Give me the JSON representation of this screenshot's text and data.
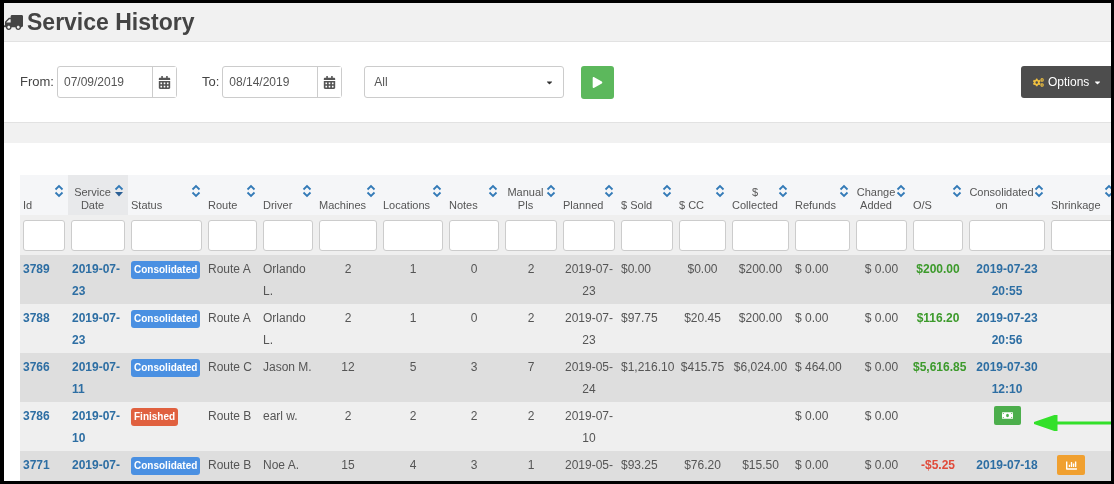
{
  "page": {
    "title": "Service History"
  },
  "filters": {
    "from_label": "From:",
    "from_value": "07/09/2019",
    "to_label": "To:",
    "to_value": "08/14/2019",
    "select_value": "All",
    "options_label": "Options"
  },
  "columns": [
    {
      "label": "Id",
      "sorted": false
    },
    {
      "label": "Service Date",
      "sorted": true
    },
    {
      "label": "Status",
      "sorted": false
    },
    {
      "label": "Route",
      "sorted": false
    },
    {
      "label": "Driver",
      "sorted": false
    },
    {
      "label": "Machines",
      "sorted": false
    },
    {
      "label": "Locations",
      "sorted": false
    },
    {
      "label": "Notes",
      "sorted": false
    },
    {
      "label": "Manual Pls",
      "sorted": false
    },
    {
      "label": "Planned",
      "sorted": false
    },
    {
      "label": "$ Sold",
      "sorted": false
    },
    {
      "label": "$ CC",
      "sorted": false
    },
    {
      "label": "$ Collected",
      "sorted": false
    },
    {
      "label": "Refunds",
      "sorted": false
    },
    {
      "label": "Change Added",
      "sorted": false
    },
    {
      "label": "O/S",
      "sorted": false
    },
    {
      "label": "Consolidated on",
      "sorted": false
    },
    {
      "label": "Shrinkage",
      "sorted": false
    }
  ],
  "rows": [
    {
      "id": "3789",
      "date": "2019-07-23",
      "status": {
        "label": "Consolidated",
        "kind": "consolidated"
      },
      "route": "Route A",
      "driver": "Orlando L.",
      "machines": "2",
      "locations": "1",
      "notes": "0",
      "manual": "2",
      "planned": "2019-07-23",
      "sold": "$0.00",
      "cc": "$0.00",
      "collected": "$200.00",
      "refunds": "$ 0.00",
      "change": "$ 0.00",
      "os": {
        "text": "$200.00",
        "kind": "positive"
      },
      "consolidated": {
        "kind": "text",
        "text": "2019-07-23 20:55"
      }
    },
    {
      "id": "3788",
      "date": "2019-07-23",
      "status": {
        "label": "Consolidated",
        "kind": "consolidated"
      },
      "route": "Route A",
      "driver": "Orlando L.",
      "machines": "2",
      "locations": "1",
      "notes": "0",
      "manual": "2",
      "planned": "2019-07-23",
      "sold": "$97.75",
      "cc": "$20.45",
      "collected": "$200.00",
      "refunds": "$ 0.00",
      "change": "$ 0.00",
      "os": {
        "text": "$116.20",
        "kind": "positive"
      },
      "consolidated": {
        "kind": "text",
        "text": "2019-07-23 20:56"
      }
    },
    {
      "id": "3766",
      "date": "2019-07-11",
      "status": {
        "label": "Consolidated",
        "kind": "consolidated"
      },
      "route": "Route C",
      "driver": "Jason M.",
      "machines": "12",
      "locations": "5",
      "notes": "3",
      "manual": "7",
      "planned": "2019-05-24",
      "sold": "$1,216.10",
      "cc": "$415.75",
      "collected": "$6,024.00",
      "refunds": "$ 464.00",
      "change": "$ 0.00",
      "os": {
        "text": "$5,616.85",
        "kind": "positive"
      },
      "consolidated": {
        "kind": "text",
        "text": "2019-07-30 12:10"
      }
    },
    {
      "id": "3786",
      "date": "2019-07-10",
      "status": {
        "label": "Finished",
        "kind": "finished"
      },
      "route": "Route B",
      "driver": "earl w.",
      "machines": "2",
      "locations": "2",
      "notes": "2",
      "manual": "2",
      "planned": "2019-07-10",
      "refunds": "$ 0.00",
      "change": "$ 0.00",
      "consolidated": {
        "kind": "cash_button"
      },
      "annotated": true
    },
    {
      "id": "3771",
      "date": "2019-07-",
      "status": {
        "label": "Consolidated",
        "kind": "consolidated"
      },
      "route": "Route B",
      "driver": "Noe A.",
      "machines": "15",
      "locations": "4",
      "notes": "3",
      "manual": "1",
      "planned": "2019-05-",
      "sold": "$93.25",
      "cc": "$76.20",
      "collected": "$15.50",
      "refunds": "$ 0.00",
      "change": "$ 0.00",
      "os": {
        "text": "-$5.25",
        "kind": "negative"
      },
      "consolidated": {
        "kind": "text",
        "text": "2019-07-18"
      },
      "shrinkage": {
        "kind": "chart_button"
      }
    }
  ]
}
